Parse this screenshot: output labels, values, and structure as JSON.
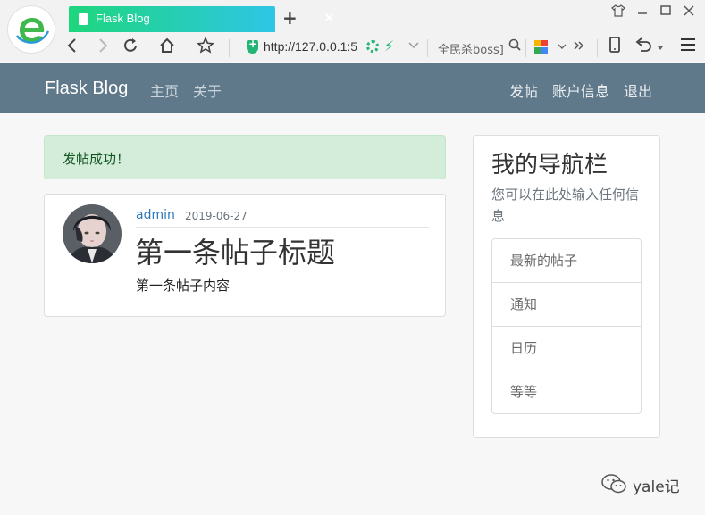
{
  "browser": {
    "tab_title": "Flask Blog",
    "url_host": "http://127.0.0.1:5",
    "search_hint": "全民杀boss]",
    "new_tab_symbol": "+",
    "tab_close_symbol": "✕"
  },
  "navbar": {
    "brand": "Flask Blog",
    "links": [
      "主页",
      "关于"
    ],
    "right_links": [
      "发帖",
      "账户信息",
      "退出"
    ]
  },
  "alert": {
    "message": "发帖成功！"
  },
  "post": {
    "author": "admin",
    "date": "2019-06-27",
    "title": "第一条帖子标题",
    "content": "第一条帖子内容"
  },
  "sidebar": {
    "title": "我的导航栏",
    "description": "您可以在此处输入任何信息",
    "items": [
      "最新的帖子",
      "通知",
      "日历",
      "等等"
    ]
  },
  "watermark": {
    "text": "yale记"
  },
  "colors": {
    "navbar": "#5f788a",
    "tab_gradient_start": "#1ed67c",
    "tab_gradient_end": "#2ec6e6",
    "alert_bg": "#d4edda",
    "alert_text": "#155724",
    "link": "#2c78b8"
  },
  "icons": [
    "browser-e-logo",
    "page-icon",
    "close-icon",
    "shirt-icon",
    "minimize-icon",
    "maximize-icon",
    "window-close-icon",
    "back-icon",
    "forward-icon",
    "reload-icon",
    "home-icon",
    "star-icon",
    "shield-icon",
    "spinner-icon",
    "bolt-icon",
    "chevron-down-icon",
    "search-icon",
    "apps-icon",
    "more-icon",
    "phone-icon",
    "undo-icon",
    "menu-icon",
    "wechat-icon"
  ]
}
